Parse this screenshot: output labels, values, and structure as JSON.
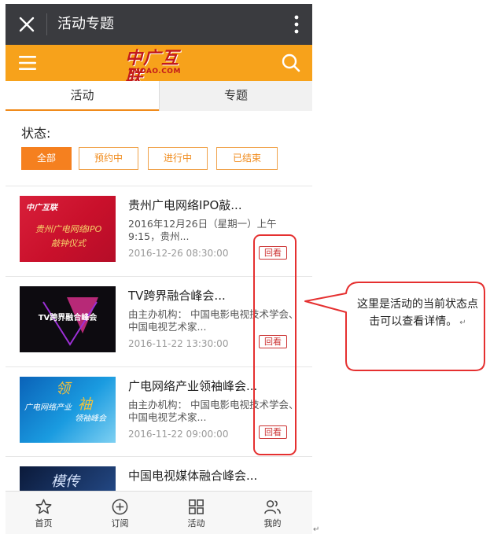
{
  "titlebar": {
    "title": "活动专题"
  },
  "header": {
    "logo_main": "中广互联",
    "logo_sub": "TVOAO.COM"
  },
  "tabs": [
    {
      "label": "活动"
    },
    {
      "label": "专题"
    }
  ],
  "status": {
    "label": "状态:",
    "filters": [
      {
        "label": "全部",
        "selected": true
      },
      {
        "label": "预约中"
      },
      {
        "label": "进行中"
      },
      {
        "label": "已结束"
      }
    ]
  },
  "items": [
    {
      "thumb_logo": "中广互联",
      "thumb_line1": "贵州广电网络IPO",
      "thumb_line2": "敲钟仪式",
      "title": "贵州广电网络IPO敲...",
      "desc": "2016年12月26日（星期一）上午9:15，贵州...",
      "time": "2016-12-26 08:30:00",
      "badge": "回看"
    },
    {
      "thumb_text": "TV跨界融合峰会",
      "title": "TV跨界融合峰会...",
      "desc": "由主办机构： 中国电影电视技术学会、中国电视艺术家...",
      "time": "2016-11-22 13:30:00",
      "badge": "回看"
    },
    {
      "thumb_text1": "广电网络产业",
      "thumb_text2": "领袖峰会",
      "thumb_big1": "领",
      "thumb_big2": "袖",
      "title": "广电网络产业领袖峰会...",
      "desc": "由主办机构： 中国电影电视技术学会、中国电视艺术家...",
      "time": "2016-11-22 09:00:00",
      "badge": "回看"
    },
    {
      "thumb_text": "模传",
      "title": "中国电视媒体融合峰会..."
    }
  ],
  "bottom_nav": [
    {
      "label": "首页",
      "icon": "star-icon"
    },
    {
      "label": "订阅",
      "icon": "plus-circle-icon"
    },
    {
      "label": "活动",
      "icon": "grid-icon"
    },
    {
      "label": "我的",
      "icon": "users-icon"
    }
  ],
  "callout": {
    "text": "这里是活动的当前状态点击可以查看详情。",
    "mark": "↵"
  },
  "colors": {
    "accent": "#f7a21b",
    "titlebar": "#3a3b3f",
    "annotation": "#e53030",
    "badge": "#cc3333"
  }
}
